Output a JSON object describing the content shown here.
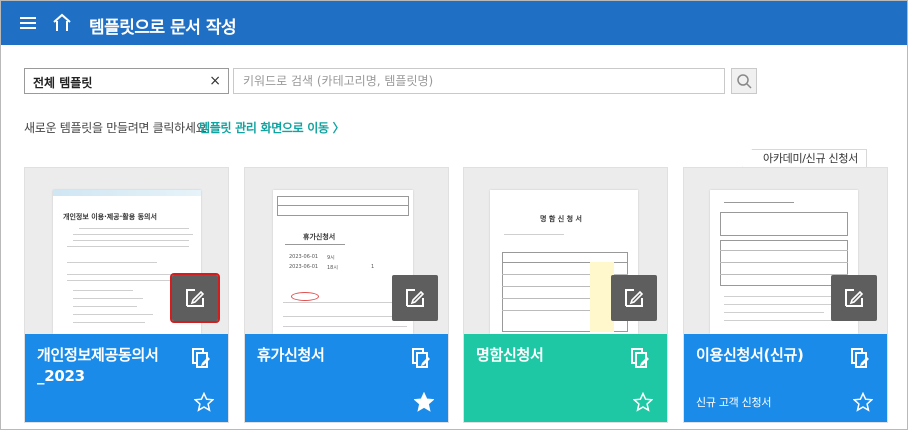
{
  "header": {
    "title": "템플릿으로 문서 작성"
  },
  "filter": {
    "value": "전체 템플릿",
    "clear_icon": "×"
  },
  "search": {
    "placeholder": "키워드로 검색 (카테고리명, 템플릿명)"
  },
  "hint": {
    "text": "새로운 템플릿을 만들려면 클릭하세요.",
    "link": "템플릿 관리 화면으로 이동 〉"
  },
  "colors": {
    "header": "#1f6fc4",
    "blue": "#1a8be8",
    "teal": "#1ec8a4",
    "link": "#11a3a0"
  },
  "cards": [
    {
      "name": "개인정보제공동의서_2023",
      "desc": "",
      "color": "#1a8be8",
      "starred": false,
      "doc": {
        "title": "개인정보 이용·제공·활용 동의서"
      }
    },
    {
      "name": "휴가신청서",
      "desc": "",
      "color": "#1a8be8",
      "starred": true,
      "doc": {
        "title": "휴가신청서",
        "date1": "2023-06-01",
        "date2": "2023-06-01",
        "time1": "9시",
        "time2": "18시",
        "days": "1"
      }
    },
    {
      "name": "명함신청서",
      "desc": "",
      "color": "#1ec8a4",
      "starred": false,
      "doc": {
        "title": "명 함 신 청 서"
      }
    },
    {
      "name": "이용신청서(신규)",
      "desc": "신규 고객 신청서",
      "color": "#1a8be8",
      "starred": false,
      "category": "아카데미/신규 신청서",
      "doc": {
        "title": ""
      }
    }
  ]
}
